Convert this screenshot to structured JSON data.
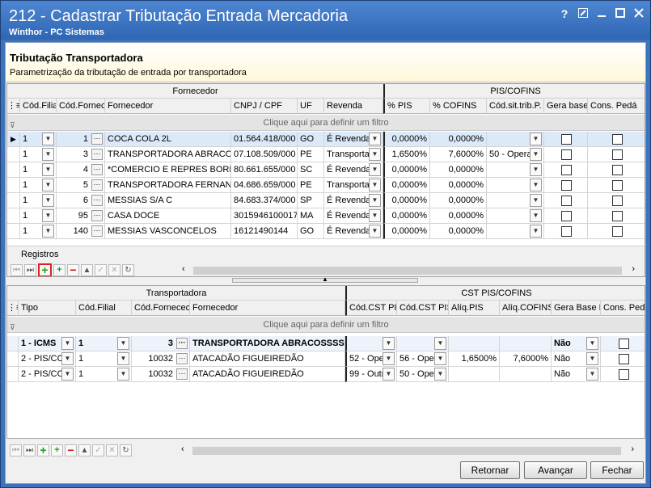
{
  "window": {
    "title": "212 - Cadastrar Tributação Entrada Mercadoria",
    "subtitle": "Winthor - PC Sistemas",
    "help_label": "?"
  },
  "header": {
    "title": "Tributação Transportadora",
    "description": "Parametrização da tributação de entrada por transportadora"
  },
  "grid1": {
    "band_fornecedor": "Fornecedor",
    "band_piscofins": "PIS/COFINS",
    "columns": [
      "Cód.Filial",
      "Cód.Fornec",
      "Fornecedor",
      "CNPJ / CPF",
      "UF",
      "Revenda",
      "% PIS",
      "% COFINS",
      "Cód.sit.trib.P.",
      "Gera base",
      "Cons. Pedá"
    ],
    "filter_text": "Clique aqui para definir um filtro",
    "rows": [
      {
        "filial": "1",
        "cod": "1",
        "fornecedor": "COCA COLA 2L",
        "cnpj": "01.564.418/000",
        "uf": "GO",
        "revenda": "É Revenda",
        "pis": "0,0000%",
        "cofins": "0,0000%",
        "sit": ""
      },
      {
        "filial": "1",
        "cod": "3",
        "fornecedor": "TRANSPORTADORA ABRACOSS",
        "cnpj": "07.108.509/000",
        "uf": "PE",
        "revenda": "Transporta",
        "pis": "1,6500%",
        "cofins": "7,6000%",
        "sit": "50 - Opera"
      },
      {
        "filial": "1",
        "cod": "4",
        "fornecedor": "*COMERCIO E REPRES  BORNH",
        "cnpj": "80.661.655/000",
        "uf": "SC",
        "revenda": "É Revenda",
        "pis": "0,0000%",
        "cofins": "0,0000%",
        "sit": ""
      },
      {
        "filial": "1",
        "cod": "5",
        "fornecedor": "TRANSPORTADORA FERNANDC",
        "cnpj": "04.686.659/000",
        "uf": "PE",
        "revenda": "Transporta",
        "pis": "0,0000%",
        "cofins": "0,0000%",
        "sit": ""
      },
      {
        "filial": "1",
        "cod": "6",
        "fornecedor": "MESSIAS S/A C",
        "cnpj": "84.683.374/000",
        "uf": "SP",
        "revenda": "É Revenda",
        "pis": "0,0000%",
        "cofins": "0,0000%",
        "sit": ""
      },
      {
        "filial": "1",
        "cod": "95",
        "fornecedor": "CASA DOCE",
        "cnpj": "3015946100017",
        "uf": "MA",
        "revenda": "É Revenda",
        "pis": "0,0000%",
        "cofins": "0,0000%",
        "sit": ""
      },
      {
        "filial": "1",
        "cod": "140",
        "fornecedor": "MESSIAS VASCONCELOS",
        "cnpj": "16121490144",
        "uf": "GO",
        "revenda": "É Revenda",
        "pis": "0,0000%",
        "cofins": "0,0000%",
        "sit": ""
      }
    ],
    "footer_label": "Registros"
  },
  "grid2": {
    "band_transportadora": "Transportadora",
    "band_cst": "CST PIS/COFINS",
    "columns": [
      "Tipo",
      "Cód.Filial",
      "Cód.Fornecec",
      "Fornecedor",
      "Cód.CST PIS",
      "Cód.CST PIS",
      "Alíq.PIS",
      "Alíq.COFINS",
      "Gera Base P",
      "Cons. Pedá"
    ],
    "filter_text": "Clique aqui para definir um filtro",
    "rows": [
      {
        "tipo": "1 - ICMS",
        "filial": "1",
        "cod": "3",
        "fornecedor": "TRANSPORTADORA ABRACOSSSS",
        "cst1": "",
        "cst2": "",
        "aliqpis": "",
        "aliqcofins": "",
        "gera": "Não"
      },
      {
        "tipo": "2 - PIS/CO",
        "filial": "1",
        "cod": "10032",
        "fornecedor": "ATACADÃO FIGUEIREDÃO",
        "cst1": "52 - Ope",
        "cst2": "56 - Ope",
        "aliqpis": "1,6500%",
        "aliqcofins": "7,6000%",
        "gera": "Não"
      },
      {
        "tipo": "2 - PIS/CO",
        "filial": "1",
        "cod": "10032",
        "fornecedor": "ATACADÃO FIGUEIREDÃO",
        "cst1": "99 - Outr",
        "cst2": "50 - Ope",
        "aliqpis": "",
        "aliqcofins": "",
        "gera": "Não"
      }
    ]
  },
  "buttons": {
    "back": "Retornar",
    "next": "Avançar",
    "close": "Fechar"
  }
}
